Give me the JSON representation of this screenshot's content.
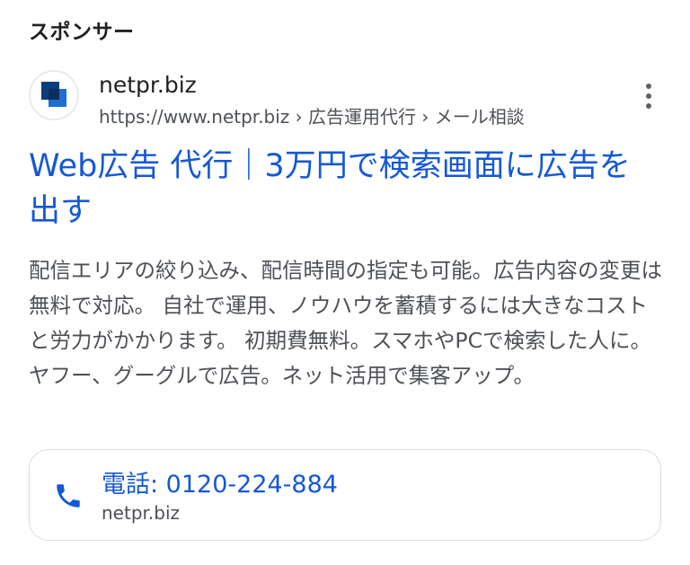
{
  "sponsor_label": "スポンサー",
  "advertiser": {
    "favicon": "netpr-logo-icon",
    "name": "netpr.biz",
    "url": "https://www.netpr.biz › 広告運用代行 › メール相談",
    "menu_icon": "more-vert-icon"
  },
  "ad": {
    "title": "Web広告 代行｜3万円で検索画面に広告を出す",
    "description": "配信エリアの絞り込み、配信時間の指定も可能。広告内容の変更は無料で対応。 自社で運用、ノウハウを蓄積するには大きなコストと労力がかかります。 初期費無料。スマホやPCで検索した人に。ヤフー、グーグルで広告。ネット活用で集客アップ。"
  },
  "call": {
    "icon": "phone-icon",
    "label": "電話: 0120-224-884",
    "domain": "netpr.biz"
  },
  "colors": {
    "title_blue": "#1558d6",
    "text_gray": "#4d5156",
    "heading_black": "#202124",
    "logo_dark": "#0b3f7a",
    "logo_light": "#1f6fd1"
  }
}
